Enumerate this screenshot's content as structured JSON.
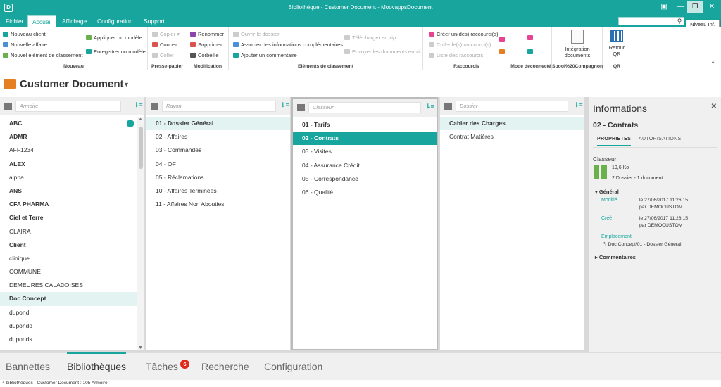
{
  "window": {
    "title": "Bibliothèque - Customer Document - MoovappsDocument",
    "app_icon": "D"
  },
  "menu": {
    "tabs": [
      "Fichier",
      "Accueil",
      "Affichage",
      "Configuration",
      "Support"
    ],
    "active": "Accueil"
  },
  "tooltip": "Niveau Inf.",
  "ribbon": {
    "nouveau": {
      "label": "Nouveau",
      "items": [
        "Nouveau client",
        "Nouvelle affaire",
        "Nouvel élément de classement",
        "Appliquer un modèle",
        "Enregistrer un modèle"
      ]
    },
    "presse_papier": {
      "label": "Presse-papier",
      "items": [
        "Copier",
        "Couper",
        "Coller"
      ]
    },
    "modification": {
      "label": "Modification",
      "items": [
        "Renommer",
        "Supprimer",
        "Corbeille"
      ]
    },
    "elements": {
      "label": "Eléments de classement",
      "items": [
        "Ouvrir le dossier",
        "Associer des informations complémentaires",
        "Ajouter un commentaire",
        "Télécharger en zip",
        "Envoyer les documents en zip"
      ]
    },
    "raccourcis": {
      "label": "Raccourcis",
      "items": [
        "Créer un(des) raccourci(s)",
        "Coller le(s) raccourci(s)",
        "Liste des raccourcis"
      ]
    },
    "deconnecte": {
      "label": "Mode déconnecté"
    },
    "spool": {
      "label": "Spool%20Compagnon",
      "button": "Intégration documents"
    },
    "qr": {
      "label": "QR",
      "button": "Retour QR"
    }
  },
  "library": {
    "title": "Customer Document"
  },
  "columns": [
    {
      "placeholder": "Armoire",
      "items": [
        "ABC",
        "ADMR",
        "AFF1234",
        "ALEX",
        "alpha",
        "ANS",
        "CFA PHARMA",
        "Ciel et Terre",
        "CLAIRA",
        "Client",
        "clinique",
        "COMMUNE",
        "DEMEURES CALADOISES",
        "Doc Concept",
        "dupond",
        "dupondd",
        "duponds"
      ]
    },
    {
      "placeholder": "Rayon",
      "items": [
        "01 - Dossier Général",
        "02 - Affaires",
        "03 - Commandes",
        "04 - OF",
        "05 - Réclamations",
        "10 - Affaires Terminées",
        "11 - Affaires Non Abouties"
      ]
    },
    {
      "placeholder": "Classeur",
      "items": [
        "01 - Tarifs",
        "02 - Contrats",
        "03 - Visites",
        "04 - Assurance Crédit",
        "05 - Correspondance",
        "06 - Qualité"
      ]
    },
    {
      "placeholder": "Dossier",
      "items": [
        "Cahier des Charges",
        "Contrat Matières"
      ]
    }
  ],
  "info": {
    "title": "Informations",
    "subtitle": "02 - Contrats",
    "tabs": [
      "PROPRIETES",
      "AUTORISATIONS"
    ],
    "type": "Classeur",
    "size": "19,6 Ko",
    "counts": "2 Dossier - 1 document",
    "general_label": "Général",
    "modified_label": "Modifié",
    "modified_value": "le 27/06/2017 11:26:15",
    "modified_by": "par DEMOCUSTOM",
    "created_label": "Créé",
    "created_value": "le 27/06/2017 11:26:15",
    "created_by": "par DEMOCUSTOM",
    "location_label": "Emplacement",
    "location_value": "Doc Concept\\01 - Dossier Général",
    "comments_label": "Commentaires"
  },
  "bottom_tabs": [
    "Bannettes",
    "Bibliothèques",
    "Tâches",
    "Recherche",
    "Configuration"
  ],
  "tasks_badge": "6",
  "status": "4 bibliothèques - Customer Document : 105 Armoire",
  "colors": {
    "accent": "#17a59d",
    "badge": "#e0281d"
  }
}
